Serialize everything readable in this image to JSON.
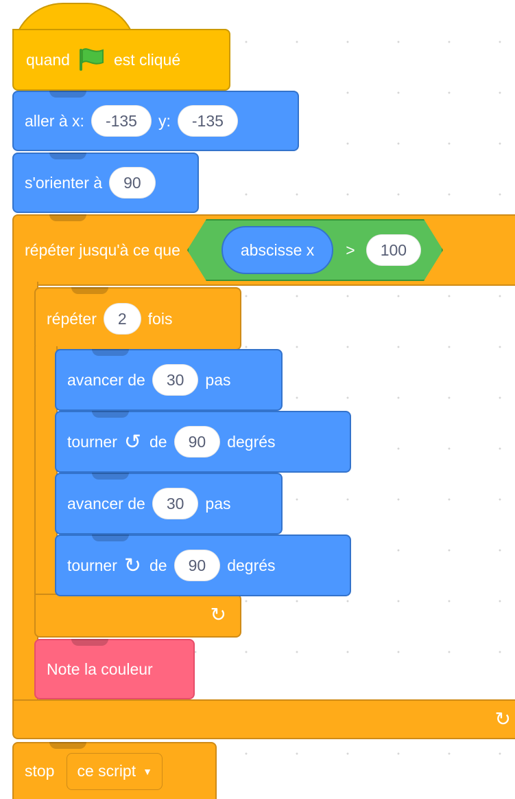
{
  "when_flag": {
    "prefix": "quand",
    "suffix": "est cliqué",
    "icon": "green-flag-icon"
  },
  "goto": {
    "label": "aller à x:",
    "x": "-135",
    "y_label": "y:",
    "y": "-135"
  },
  "point": {
    "label": "s'orienter à",
    "value": "90"
  },
  "repeat_until": {
    "label": "répéter jusqu'à ce que",
    "reporter": "abscisse x",
    "operator": ">",
    "value": "100"
  },
  "repeat": {
    "label": "répéter",
    "count": "2",
    "suffix": "fois"
  },
  "inner": [
    {
      "label": "avancer de",
      "value": "30",
      "suffix": "pas"
    },
    {
      "label": "tourner",
      "icon": "rotate-left-icon",
      "mid": "de",
      "value": "90",
      "suffix": "degrés"
    },
    {
      "label": "avancer de",
      "value": "30",
      "suffix": "pas"
    },
    {
      "label": "tourner",
      "icon": "rotate-right-icon",
      "mid": "de",
      "value": "90",
      "suffix": "degrés"
    }
  ],
  "custom": {
    "label": "Note la couleur"
  },
  "stop": {
    "label": "stop",
    "option": "ce script",
    "dropdown_icon": "triangle-down-icon"
  },
  "colors": {
    "events": "#FFBF00",
    "motion": "#4C97FF",
    "control": "#FFAB19",
    "operators": "#59C059",
    "my_blocks": "#FF6680"
  }
}
